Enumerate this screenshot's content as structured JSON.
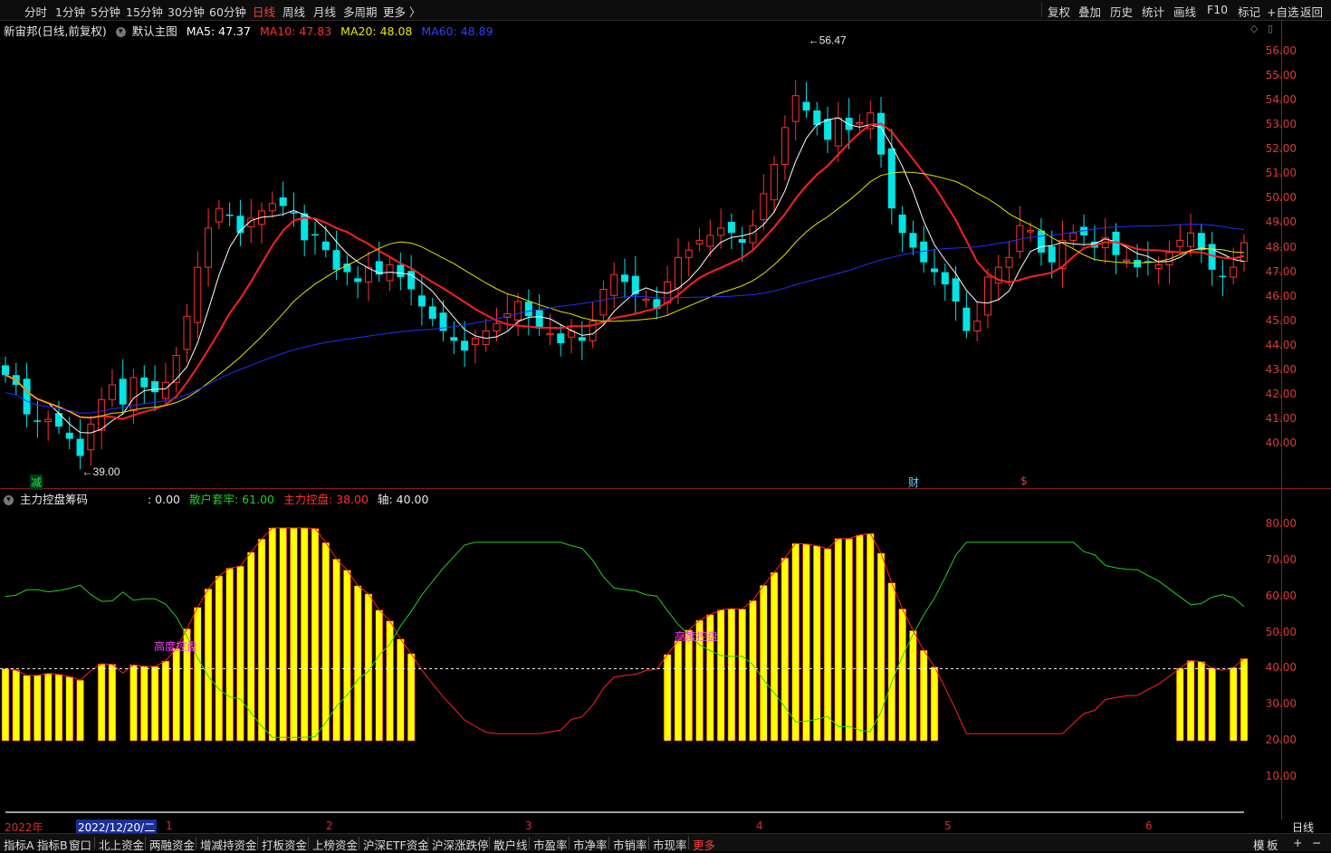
{
  "toolbar": {
    "periods": [
      "分时",
      "1分钟",
      "5分钟",
      "15分钟",
      "30分钟",
      "60分钟",
      "日线",
      "周线",
      "月线",
      "多周期",
      "更多 〉"
    ],
    "active_period": "日线",
    "right_buttons": [
      "复权",
      "叠加",
      "历史",
      "统计",
      "画线",
      "F10",
      "标记",
      "+自选",
      "返回"
    ]
  },
  "main_chart": {
    "stock_title": "新宙邦(日线,前复权)",
    "template_label": "默认主图",
    "ma5": "MA5: 47.37",
    "ma10": "MA10: 47.83",
    "ma20": "MA20: 48.08",
    "ma60": "MA60: 48.89",
    "high_label": "56.47",
    "low_label": "39.00",
    "y_ticks": [
      "56.00",
      "55.00",
      "54.00",
      "53.00",
      "52.00",
      "51.00",
      "50.00",
      "49.00",
      "48.00",
      "47.00",
      "46.00",
      "45.00",
      "44.00",
      "43.00",
      "42.00",
      "41.00",
      "40.00"
    ],
    "markers": [
      "减",
      "财",
      "$"
    ],
    "colors": {
      "ma5": "#ffffff",
      "ma10": "#ff2020",
      "ma20": "#e0e000",
      "ma60": "#2030ff",
      "up": "#ff3030",
      "down": "#00e5e5"
    }
  },
  "indicator": {
    "name": "主力控盘筹码",
    "value0": ": 0.00",
    "retail": "散户套牢: 61.00",
    "main_control": "主力控盘: 38.00",
    "axis": "轴: 40.00",
    "annotations": [
      "高度控盘",
      "高度控盘"
    ],
    "y_ticks": [
      "80.00",
      "70.00",
      "60.00",
      "50.00",
      "40.00",
      "30.00",
      "20.00",
      "10.00"
    ]
  },
  "timeline": {
    "year": "2022年",
    "cursor_date": "2022/12/20/二",
    "months": [
      "1",
      "2",
      "3",
      "4",
      "5",
      "6"
    ],
    "period_label": "日线"
  },
  "bottom_tabs": [
    "指标A",
    "指标B",
    "窗口",
    "北上资金",
    "两融资金",
    "增减持资金",
    "打板资金",
    "上榜资金",
    "沪深ETF资金",
    "沪深涨跌停",
    "散户线",
    "市盈率",
    "市净率",
    "市销率",
    "市现率",
    "更多"
  ],
  "bottom_right": [
    "模",
    "板",
    "+",
    "−"
  ],
  "chart_data": {
    "type": "candlestick",
    "x_axis_months": [
      "2022年",
      "1",
      "2",
      "3",
      "4",
      "5",
      "6"
    ],
    "ylim_price": [
      39,
      56.5
    ],
    "annotated_high": 56.47,
    "annotated_low": 39.0,
    "ma": {
      "MA5": 47.37,
      "MA10": 47.83,
      "MA20": 48.08,
      "MA60": 48.89
    },
    "close": [
      42.8,
      42.4,
      41.2,
      40.9,
      41.0,
      40.7,
      40.2,
      39.5,
      40.8,
      41.8,
      42.4,
      41.6,
      42.7,
      42.3,
      42.1,
      42.5,
      43.6,
      45.2,
      47.2,
      48.8,
      49.6,
      49.3,
      48.6,
      49.2,
      49.5,
      49.8,
      49.7,
      49.4,
      48.3,
      48.5,
      47.9,
      47.1,
      47.0,
      46.6,
      47.2,
      46.9,
      47.3,
      46.8,
      46.3,
      45.6,
      45.1,
      44.6,
      44.2,
      43.8,
      44.3,
      44.6,
      44.9,
      45.3,
      45.8,
      45.2,
      44.7,
      44.5,
      44.1,
      44.6,
      44.2,
      45.0,
      46.3,
      46.9,
      46.6,
      46.1,
      45.9,
      45.5,
      46.6,
      47.6,
      47.9,
      48.3,
      48.5,
      48.8,
      48.6,
      48.2,
      48.9,
      50.2,
      51.4,
      52.9,
      54.2,
      53.6,
      53.0,
      52.4,
      53.3,
      52.8,
      53.1,
      53.5,
      51.8,
      49.6,
      48.6,
      48.0,
      47.4,
      47.0,
      46.5,
      45.8,
      44.6,
      45.0,
      46.8,
      47.2,
      47.6,
      48.9,
      48.7,
      47.8,
      47.4,
      48.3,
      48.6,
      48.5,
      48.0,
      48.4,
      47.7,
      47.5,
      47.2,
      47.4,
      47.3,
      47.8,
      48.3,
      48.6,
      47.9,
      47.1,
      46.8,
      47.2,
      48.2
    ],
    "indicator_series": [
      {
        "name": "散户套牢",
        "last": 61.0
      },
      {
        "name": "主力控盘",
        "last": 38.0
      },
      {
        "name": "轴",
        "last": 40.0
      }
    ],
    "indicator_ylim": [
      10,
      80
    ]
  }
}
